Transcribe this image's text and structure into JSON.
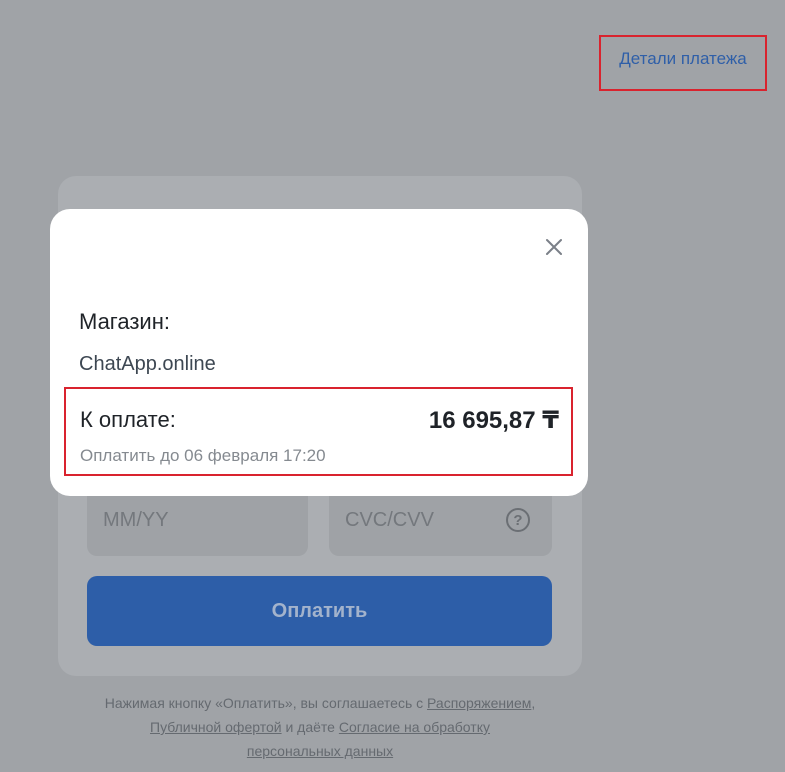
{
  "header": {
    "details_link": "Детали платежа"
  },
  "form": {
    "expiry_placeholder": "MM/YY",
    "cvc_placeholder": "CVC/CVV",
    "help_icon": "question-circle-icon",
    "pay_label": "Оплатить"
  },
  "terms": {
    "before": "Нажимая кнопку «Оплатить», вы соглашаетесь с ",
    "link1": "Распоряжением",
    "sep1": ",",
    "link2": "Публичной офертой",
    "middle": " и даёте ",
    "link3": "Согласие на обработку",
    "link4": "персональных данных"
  },
  "modal": {
    "close_icon": "close-icon",
    "shop_label": "Магазин:",
    "shop_value": "ChatApp.online",
    "amount_label": "К оплате:",
    "amount_value": "16 695,87 ₸",
    "due": "Оплатить до 06 февраля 17:20"
  },
  "colors": {
    "overlay": "#a0a3a7",
    "accent": "#2d5ea8",
    "highlight_border": "#d9232e",
    "link": "#2f5fa8"
  }
}
